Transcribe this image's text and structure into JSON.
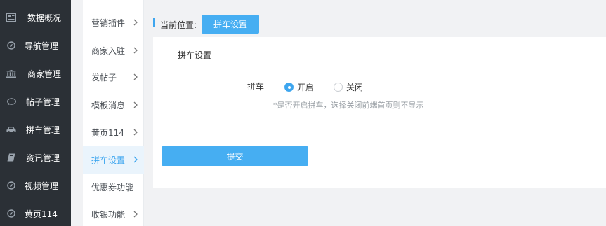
{
  "sidebar": {
    "items": [
      {
        "label": "数据概况",
        "icon": "newspaper-icon"
      },
      {
        "label": "导航管理",
        "icon": "compass-icon"
      },
      {
        "label": "商家管理",
        "icon": "bank-icon"
      },
      {
        "label": "帖子管理",
        "icon": "comment-icon"
      },
      {
        "label": "拼车管理",
        "icon": "car-icon"
      },
      {
        "label": "资讯管理",
        "icon": "book-icon"
      },
      {
        "label": "视频管理",
        "icon": "compass-icon"
      },
      {
        "label": "黄页114",
        "icon": "compass-icon"
      }
    ]
  },
  "submenu": {
    "items": [
      {
        "label": "营销插件",
        "has_arrow": true
      },
      {
        "label": "商家入驻",
        "has_arrow": true
      },
      {
        "label": "发帖子",
        "has_arrow": true
      },
      {
        "label": "模板消息",
        "has_arrow": true
      },
      {
        "label": "黄页114",
        "has_arrow": true
      },
      {
        "label": "拼车设置",
        "has_arrow": true,
        "active": true
      },
      {
        "label": "优惠券功能",
        "has_arrow": false
      },
      {
        "label": "收银功能",
        "has_arrow": true
      }
    ]
  },
  "breadcrumb": {
    "label": "当前位置:",
    "current": "拼车设置"
  },
  "card": {
    "title": "拼车设置",
    "field": {
      "label": "拼车",
      "options": [
        {
          "label": "开启",
          "selected": true
        },
        {
          "label": "关闭",
          "selected": false
        }
      ],
      "hint": "*是否开启拼车，选择关闭前端首页则不显示"
    },
    "submit_label": "提交"
  },
  "colors": {
    "sidebar_bg": "#2b3036",
    "accent": "#46aef2",
    "active_bg": "#eaf4fc"
  }
}
